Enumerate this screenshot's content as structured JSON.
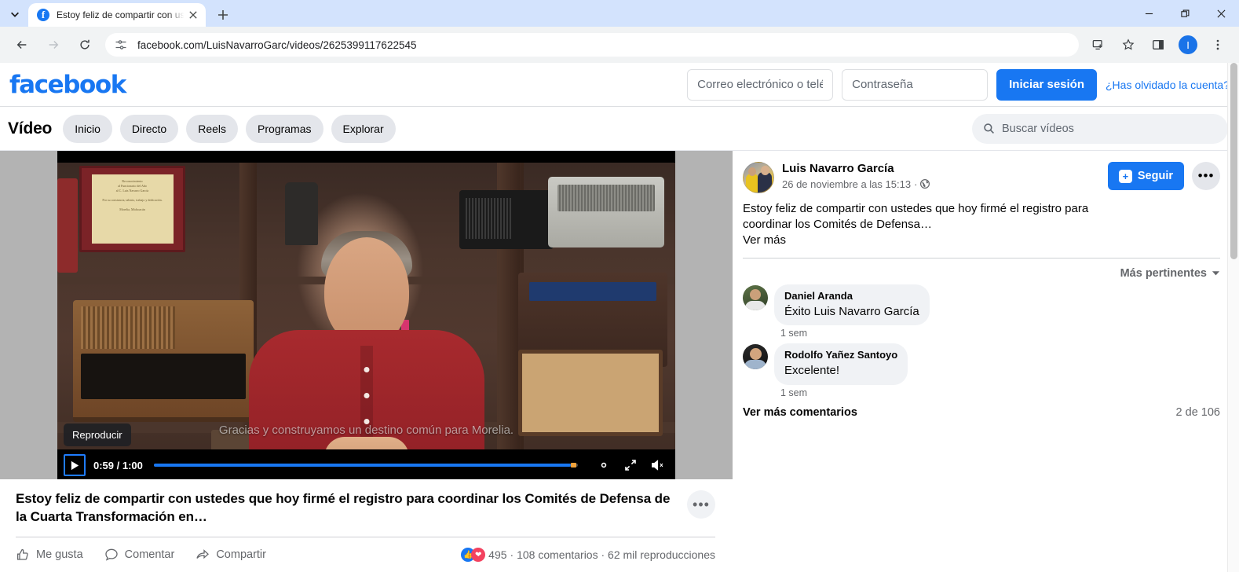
{
  "browser": {
    "tab": {
      "title": "Estoy feliz de compartir con ust",
      "favicon": "facebook-favicon"
    },
    "new_tab_label": "+",
    "window_controls": {
      "minimize": "minimize-icon",
      "maximize": "restore-icon",
      "close": "close-icon"
    },
    "nav": {
      "back": "back-arrow-icon",
      "forward": "forward-arrow-icon",
      "reload": "reload-icon"
    },
    "address": {
      "url": "facebook.com/LuisNavarroGarc/videos/2625399117622545",
      "site_info_icon": "page-settings-icon"
    },
    "toolbar_right": {
      "install_icon": "install-app-icon",
      "bookmark_icon": "star-icon",
      "sidepanel_icon": "side-panel-icon",
      "profile_initial": "I",
      "menu_icon": "three-dot-menu-icon"
    }
  },
  "fb_header": {
    "logo": "facebook",
    "email_placeholder": "Correo electrónico o teléfono",
    "password_placeholder": "Contraseña",
    "login_label": "Iniciar sesión",
    "forgot_label": "¿Has olvidado la cuenta?",
    "accent": "#1877f2"
  },
  "video_nav": {
    "title": "Vídeo",
    "pills": [
      {
        "label": "Inicio"
      },
      {
        "label": "Directo"
      },
      {
        "label": "Reels"
      },
      {
        "label": "Programas"
      },
      {
        "label": "Explorar"
      }
    ],
    "search_placeholder": "Buscar vídeos",
    "search_icon": "search-icon"
  },
  "player": {
    "tooltip": "Reproducir",
    "play_icon": "play-icon",
    "time": "0:59 / 1:00",
    "current_time": "0:59",
    "duration": "1:00",
    "progress_percent": 98.3,
    "settings_icon": "gear-icon",
    "fullscreen_icon": "fullscreen-icon",
    "volume_icon": "volume-muted-icon",
    "caption": "Gracias y construyamos un destino común para Morelia."
  },
  "post": {
    "title": "Estoy feliz de compartir con ustedes que hoy firmé el registro para coordinar los Comités de Defensa de la Cuarta Transformación en…",
    "more_icon": "ellipsis-icon",
    "actions": [
      {
        "label": "Me gusta",
        "icon": "thumbs-up-icon"
      },
      {
        "label": "Comentar",
        "icon": "comment-bubble-icon"
      },
      {
        "label": "Compartir",
        "icon": "share-arrow-icon"
      }
    ],
    "reactions": {
      "like_icon": "like-reaction-icon",
      "love_icon": "love-reaction-icon",
      "count": "495"
    },
    "stats": "· 108 comentarios · 62 mil reproducciones"
  },
  "rail": {
    "poster_name": "Luis Navarro García",
    "poster_time": "26 de noviembre a las 15:13",
    "privacy_icon": "globe-icon",
    "separator": "·",
    "follow_label": "Seguir",
    "follow_icon": "follow-plus-icon",
    "kebab_icon": "ellipsis-icon",
    "post_text": "Estoy feliz de compartir con ustedes que hoy firmé el registro para coordinar los Comités de Defensa…",
    "see_more": "Ver más",
    "sort_label": "Más pertinentes",
    "sort_caret": "chevron-down-icon",
    "comments": [
      {
        "name": "Daniel Aranda",
        "text": "Éxito Luis Navarro García",
        "time": "1 sem",
        "avatar": "a-daniel"
      },
      {
        "name": "Rodolfo Yañez Santoyo",
        "text": "Excelente!",
        "time": "1 sem",
        "avatar": "a-rodolfo"
      }
    ],
    "see_more_comments": "Ver más comentarios",
    "comment_count": "2 de 106"
  }
}
